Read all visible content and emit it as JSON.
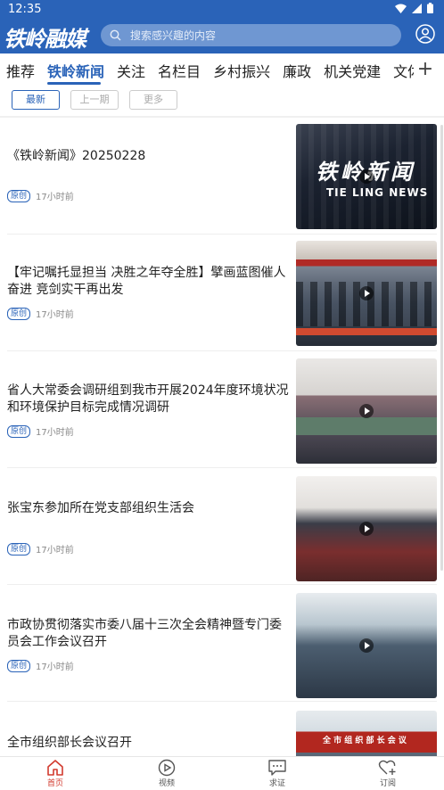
{
  "status": {
    "time": "12:35"
  },
  "header": {
    "logo": "铁岭融媒",
    "search_placeholder": "搜索感兴趣的内容"
  },
  "tabs": [
    "推荐",
    "铁岭新闻",
    "关注",
    "名栏目",
    "乡村振兴",
    "廉政",
    "机关党建",
    "文体旅"
  ],
  "active_tab": "铁岭新闻",
  "plus_label": "+",
  "subtabs": {
    "latest": "最新",
    "previous": "上一期",
    "more": "更多"
  },
  "news": [
    {
      "title": "《铁岭新闻》20250228",
      "badge": "原创",
      "time": "17小时前",
      "thumb_caption": "铁岭新闻",
      "thumb_sub": "TIE LING NEWS"
    },
    {
      "title": "【牢记嘱托显担当 决胜之年夺全胜】擘画蓝图催人奋进 竞剑实干再出发",
      "badge": "原创",
      "time": "17小时前"
    },
    {
      "title": "省人大常委会调研组到我市开展2024年度环境状况和环境保护目标完成情况调研",
      "badge": "原创",
      "time": "17小时前"
    },
    {
      "title": "张宝东参加所在党支部组织生活会",
      "badge": "原创",
      "time": "17小时前"
    },
    {
      "title": "市政协贯彻落实市委八届十三次全会精神暨专门委员会工作会议召开",
      "badge": "原创",
      "time": "17小时前"
    },
    {
      "title": "全市组织部长会议召开",
      "badge": "",
      "time": "",
      "thumb_caption": "全 市 组 织 部 长 会 议"
    }
  ],
  "bottom_nav": [
    {
      "label": "首页",
      "icon": "home-icon",
      "active": true
    },
    {
      "label": "视频",
      "icon": "video-icon",
      "active": false
    },
    {
      "label": "求证",
      "icon": "message-icon",
      "active": false
    },
    {
      "label": "订阅",
      "icon": "heart-plus-icon",
      "active": false
    }
  ],
  "colors": {
    "brand": "#2a63b8",
    "nav_active": "#d23a2e"
  }
}
